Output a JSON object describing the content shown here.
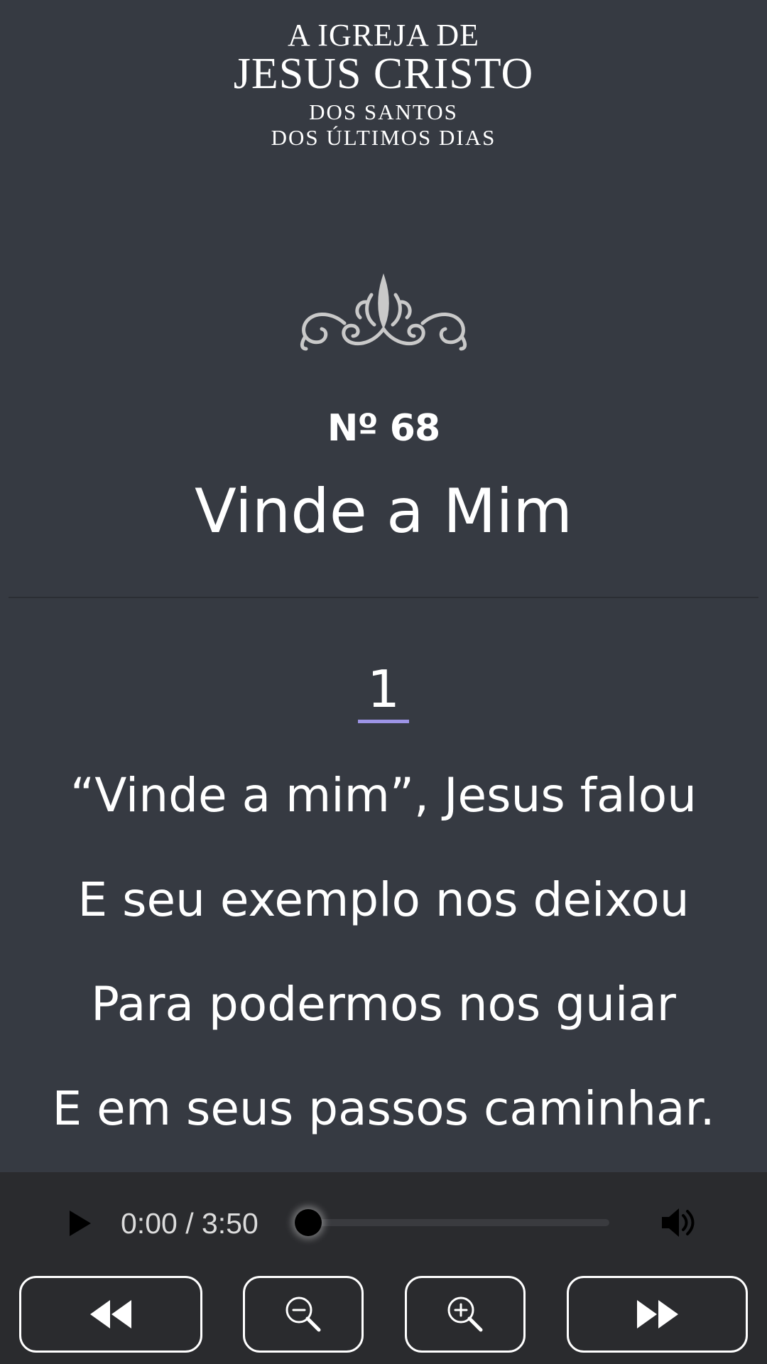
{
  "header": {
    "logo_line1": "A IGREJA DE",
    "logo_line2": "JESUS CRISTO",
    "logo_line3": "DOS SANTOS",
    "logo_line4": "DOS ÚLTIMOS DIAS"
  },
  "hymn": {
    "number": "Nº 68",
    "title": "Vinde a Mim"
  },
  "verse": {
    "number": "1",
    "lines": [
      "“Vinde a mim”, Jesus falou",
      "E seu exemplo nos deixou",
      "Para podermos nos guiar",
      "E em seus passos caminhar."
    ]
  },
  "player": {
    "time": "0:00 / 3:50",
    "progress": 0,
    "icons": {
      "play": "play-icon",
      "volume": "volume-icon"
    }
  },
  "controls": {
    "icons": [
      "rewind-icon",
      "zoom-out-icon",
      "zoom-in-icon",
      "fast-forward-icon"
    ]
  },
  "colors": {
    "background": "#363a42",
    "player_background": "#2a2b2e",
    "accent": "#9d94e6",
    "text": "#ffffff"
  }
}
